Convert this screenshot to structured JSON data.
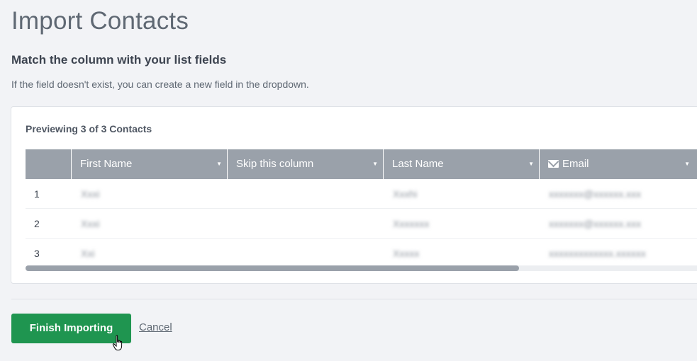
{
  "page": {
    "title": "Import Contacts",
    "subheading": "Match the column with your list fields",
    "helper_text": "If the field doesn't exist, you can create a new field in the dropdown."
  },
  "preview": {
    "label": "Previewing 3 of 3 Contacts",
    "columns": [
      {
        "label": "First Name",
        "icon": "caret-down-icon"
      },
      {
        "label": "Skip this column",
        "icon": "caret-down-icon"
      },
      {
        "label": "Last Name",
        "icon": "caret-down-icon"
      },
      {
        "label": "Email",
        "prefix_icon": "envelope-icon",
        "icon": "caret-down-icon"
      }
    ],
    "rows": [
      {
        "index": "1",
        "first_name": "Xxxi",
        "skip": "",
        "last_name": "Xxxhi",
        "email": "xxxxxxx@xxxxxx.xxx"
      },
      {
        "index": "2",
        "first_name": "Xxxi",
        "skip": "",
        "last_name": "Xxxxxxx",
        "email": "xxxxxxx@xxxxxx.xxx"
      },
      {
        "index": "3",
        "first_name": "Xxi",
        "skip": "",
        "last_name": "Xxxxx",
        "email": "xxxxxxxxxxxxx.xxxxxx"
      }
    ],
    "scroll_fraction_visible": 0.725
  },
  "actions": {
    "finish_label": "Finish Importing",
    "cancel_label": "Cancel"
  },
  "colors": {
    "header_bg": "#9aa1aa",
    "primary": "#1f9550",
    "page_bg": "#f2f3f6"
  }
}
